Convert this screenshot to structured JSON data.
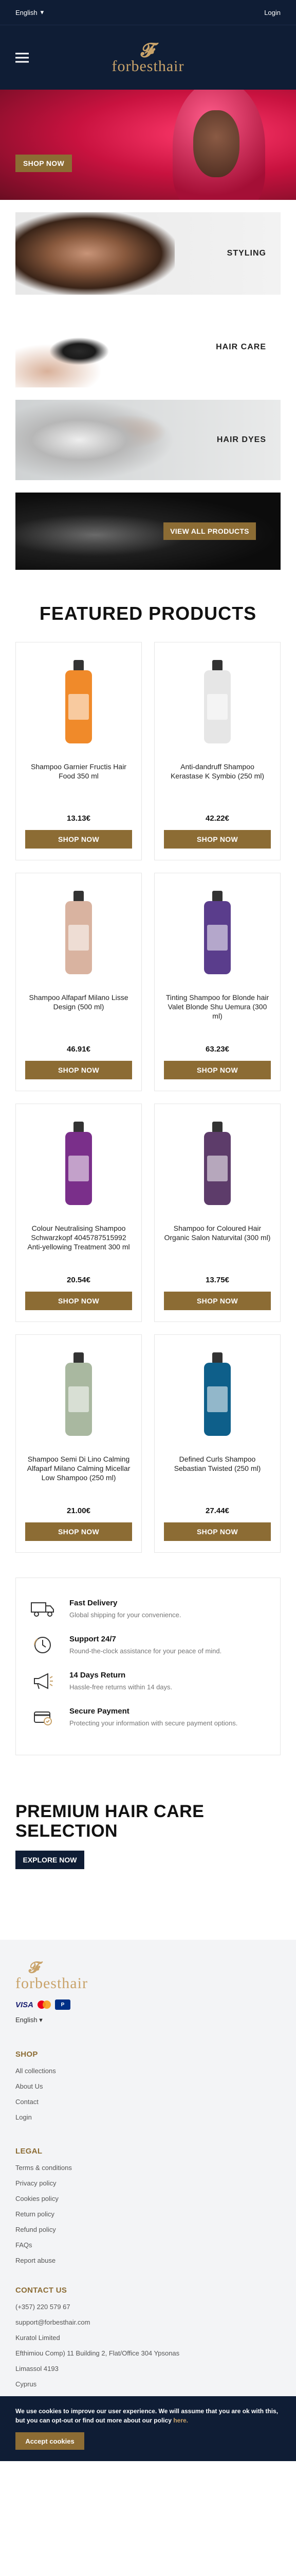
{
  "topbar": {
    "language": "English",
    "language_arrow": "▾",
    "login": "Login"
  },
  "header": {
    "logo_mark": "𝓕",
    "logo_text": "forbesthair"
  },
  "hero": {
    "button": "SHOP NOW"
  },
  "categories": [
    {
      "label": "STYLING"
    },
    {
      "label": "HAIR CARE"
    },
    {
      "label": "HAIR DYES"
    }
  ],
  "banner": {
    "button": "VIEW ALL PRODUCTS"
  },
  "featured": {
    "title": "FEATURED PRODUCTS",
    "button": "SHOP NOW"
  },
  "products": [
    {
      "name": "Shampoo Garnier Fructis Hair Food 350 ml",
      "price": "13.13€",
      "color": "#f08a2a"
    },
    {
      "name": "Anti-dandruff Shampoo Kerastase K Symbio (250 ml)",
      "price": "42.22€",
      "color": "#e6e6e6"
    },
    {
      "name": "Shampoo Alfaparf Milano Lisse Design (500 ml)",
      "price": "46.91€",
      "color": "#d9b3a0"
    },
    {
      "name": "Tinting Shampoo for Blonde hair Valet Blonde Shu Uemura (300 ml)",
      "price": "63.23€",
      "color": "#5a3d8c"
    },
    {
      "name": "Colour Neutralising Shampoo Schwarzkopf 4045787515992 Anti-yellowing Treatment 300 ml",
      "price": "20.54€",
      "color": "#7a2f8a"
    },
    {
      "name": "Shampoo for Coloured Hair Organic Salon Naturvital (300 ml)",
      "price": "13.75€",
      "color": "#5d3c6a"
    },
    {
      "name": "Shampoo Semi Di Lino Calming Alfaparf Milano Calming Micellar Low Shampoo (250 ml)",
      "price": "21.00€",
      "color": "#a9b8a0"
    },
    {
      "name": "Defined Curls Shampoo Sebastian Twisted (250 ml)",
      "price": "27.44€",
      "color": "#0e5f8a"
    }
  ],
  "features": [
    {
      "title": "Fast Delivery",
      "desc": "Global shipping for your convenience.",
      "icon": "truck-icon"
    },
    {
      "title": "Support 24/7",
      "desc": "Round-the-clock assistance for your peace of mind.",
      "icon": "support-icon"
    },
    {
      "title": "14 Days Return",
      "desc": "Hassle-free returns within 14 days.",
      "icon": "megaphone-icon"
    },
    {
      "title": "Secure Payment",
      "desc": "Protecting your information with secure payment options.",
      "icon": "secure-payment-icon"
    }
  ],
  "premium": {
    "title": "PREMIUM HAIR CARE SELECTION",
    "button": "EXPLORE NOW"
  },
  "footer": {
    "logo_mark": "𝓕",
    "logo_text": "forbesthair",
    "payment": {
      "visa": "VISA",
      "paypal": "P"
    },
    "language": "English",
    "shop": {
      "title": "SHOP",
      "links": [
        "All collections",
        "About Us",
        "Contact",
        "Login"
      ]
    },
    "legal": {
      "title": "LEGAL",
      "links": [
        "Terms & conditions",
        "Privacy policy",
        "Cookies policy",
        "Return policy",
        "Refund policy",
        "FAQs",
        "Report abuse"
      ]
    },
    "contact": {
      "title": "CONTACT US",
      "lines": [
        "(+357) 220 579 67",
        "support@forbesthair.com",
        "Kuratol Limited",
        "Efthimiou Comp) 11 Building 2, Flat/Office 304 Ypsonas",
        "Limassol 4193",
        "Cyprus"
      ]
    }
  },
  "cookie": {
    "text": "We use cookies to improve our user experience. We will assume that you are ok with this, but you can opt-out or find out more about our policy",
    "link": "here.",
    "button": "Accept cookies"
  },
  "colors": {
    "navy": "#0f1d35",
    "gold": "#8c6c34",
    "logo_gold": "#c9a36a"
  }
}
